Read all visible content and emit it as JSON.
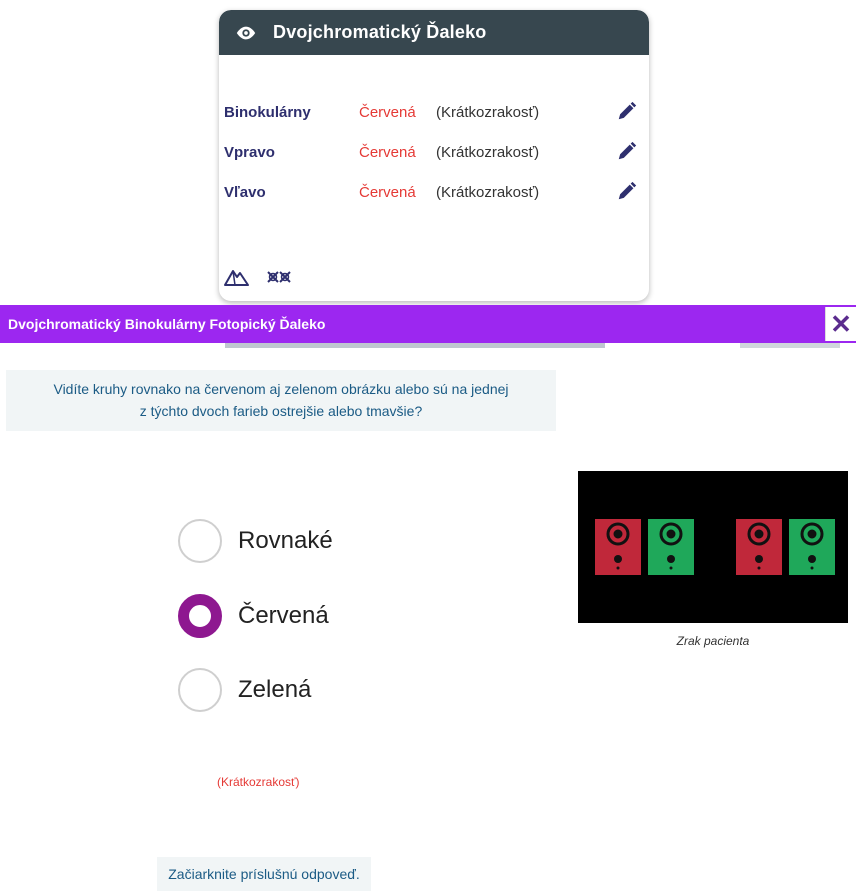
{
  "card": {
    "title": "Dvojchromatický Ďaleko",
    "rows": [
      {
        "side": "Binokulárny",
        "color": "Červená",
        "condition": "(Krátkozrakosť)"
      },
      {
        "side": "Vpravo",
        "color": "Červená",
        "condition": "(Krátkozrakosť)"
      },
      {
        "side": "Vľavo",
        "color": "Červená",
        "condition": "(Krátkozrakosť)"
      }
    ]
  },
  "dialog": {
    "title": "Dvojchromatický Binokulárny Fotopický Ďaleko",
    "close_label": "✕"
  },
  "question": {
    "line1": "Vidíte kruhy rovnako na červenom aj zelenom obrázku alebo sú na jednej",
    "line2": "z týchto dvoch farieb ostrejšie alebo tmavšie?"
  },
  "options": [
    {
      "label": "Rovnaké",
      "checked": false
    },
    {
      "label": "Červená",
      "checked": true
    },
    {
      "label": "Zelená",
      "checked": false
    }
  ],
  "image": {
    "caption": "Zrak pacienta"
  },
  "result_hint": "(Krátkozrakosť)",
  "instruction": "Začiarknite príslušnú odpoveď.",
  "colors": {
    "header": "#37474f",
    "titlebar": "#9c27f0",
    "accent_radio": "#8e1890",
    "red": "#e53935",
    "green": "#1faa59",
    "text_blue": "#1b5b85",
    "label_navy": "#2e2f6e"
  }
}
